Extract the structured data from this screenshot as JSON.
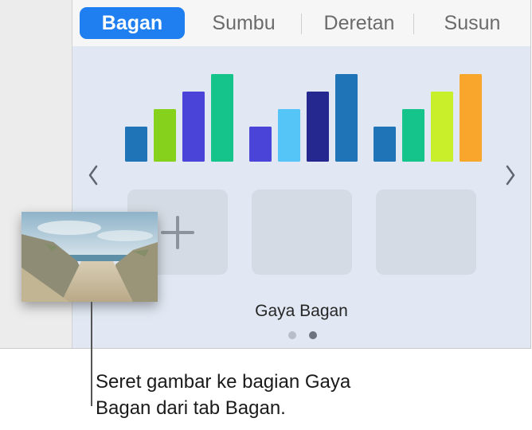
{
  "tabs": [
    {
      "label": "Bagan",
      "active": true
    },
    {
      "label": "Sumbu",
      "active": false
    },
    {
      "label": "Deretan",
      "active": false
    },
    {
      "label": "Susun",
      "active": false
    }
  ],
  "chart_styles": {
    "section_label": "Gaya Bagan",
    "page_count": 2,
    "current_page": 2,
    "styles": [
      {
        "name": "style-1",
        "bar_colors": [
          "#1f74b8",
          "#86d11c",
          "#4a44d8",
          "#15c48a"
        ]
      },
      {
        "name": "style-2",
        "bar_colors": [
          "#4a44d8",
          "#55c4f7",
          "#24288f",
          "#1f74b8"
        ]
      },
      {
        "name": "style-3",
        "bar_colors": [
          "#1f74b8",
          "#15c48a",
          "#c8ef2a",
          "#f9a72c"
        ]
      }
    ],
    "relative_bar_values": [
      0.4,
      0.6,
      0.8,
      1.0
    ],
    "custom_slots": 3
  },
  "icons": {
    "prev": "chevron-left-icon",
    "next": "chevron-right-icon",
    "add": "plus-icon"
  },
  "callout": {
    "line1": "Seret gambar ke bagian Gaya",
    "line2": "Bagan dari tab Bagan."
  },
  "colors": {
    "accent": "#1f7ff0",
    "panel_bg": "#e1e8f3",
    "placeholder_bg": "#d5dbe4",
    "dot_active": "#6d7480",
    "dot_inactive": "#b7bec9"
  }
}
